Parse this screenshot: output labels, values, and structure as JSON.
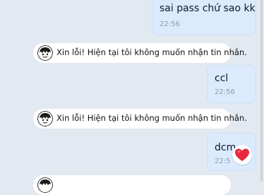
{
  "messages": [
    {
      "text": "sai pass chứ sao kk",
      "time": "22:56"
    },
    {
      "text": "ccl",
      "time": "22:56"
    },
    {
      "text": "dcm",
      "time": "22:5"
    }
  ],
  "notice": {
    "text": "Xin lỗi! Hiện tại tôi không muốn nhận tin nhắn."
  },
  "reaction": {
    "icon": "heart-icon",
    "color": "#e8283c"
  },
  "colors": {
    "background": "#e2e9f1",
    "outgoing_bubble": "#dbeafc"
  }
}
